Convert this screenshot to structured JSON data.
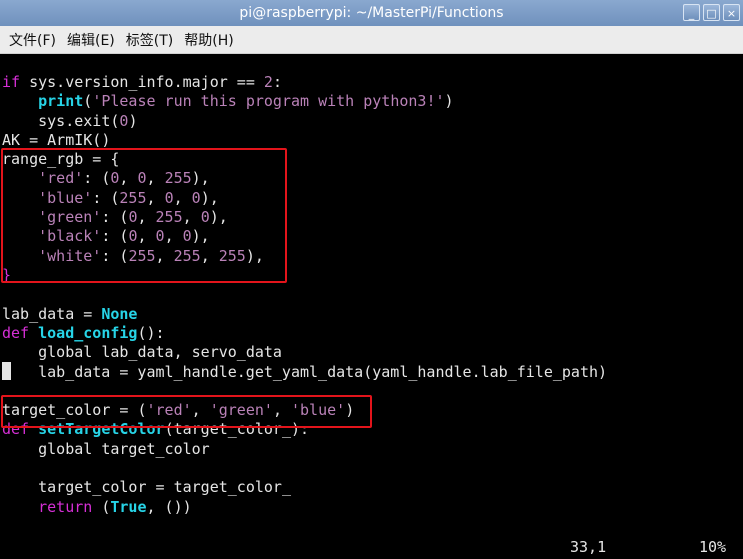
{
  "window": {
    "title": "pi@raspberrypi: ~/MasterPi/Functions",
    "controls": [
      "_",
      "□",
      "×"
    ]
  },
  "menu": [
    "文件(F)",
    "编辑(E)",
    "标签(T)",
    "帮助(H)"
  ],
  "code": [
    {
      "name": "code-line-if-version",
      "tokens": [
        {
          "t": "if",
          "c": "kw"
        },
        {
          "t": " sys.version_info.major == "
        },
        {
          "t": "2",
          "c": "num"
        },
        {
          "t": ":"
        }
      ]
    },
    {
      "name": "code-line-print",
      "tokens": [
        {
          "t": "    "
        },
        {
          "t": "print",
          "c": "fn"
        },
        {
          "t": "("
        },
        {
          "t": "'Please run this program with python3!'",
          "c": "str"
        },
        {
          "t": ")"
        }
      ]
    },
    {
      "name": "code-line-exit",
      "tokens": [
        {
          "t": "    sys.exit("
        },
        {
          "t": "0",
          "c": "num"
        },
        {
          "t": ")"
        }
      ]
    },
    {
      "name": "code-line-ak",
      "tokens": [
        {
          "t": "AK = ArmIK()"
        }
      ]
    },
    {
      "name": "code-line-range-rgb",
      "tokens": [
        {
          "t": "range_rgb = {"
        }
      ]
    },
    {
      "name": "code-line-red",
      "tokens": [
        {
          "t": "    "
        },
        {
          "t": "'red'",
          "c": "str"
        },
        {
          "t": ": ("
        },
        {
          "t": "0",
          "c": "num"
        },
        {
          "t": ", "
        },
        {
          "t": "0",
          "c": "num"
        },
        {
          "t": ", "
        },
        {
          "t": "255",
          "c": "num"
        },
        {
          "t": "),"
        }
      ]
    },
    {
      "name": "code-line-blue",
      "tokens": [
        {
          "t": "    "
        },
        {
          "t": "'blue'",
          "c": "str"
        },
        {
          "t": ": ("
        },
        {
          "t": "255",
          "c": "num"
        },
        {
          "t": ", "
        },
        {
          "t": "0",
          "c": "num"
        },
        {
          "t": ", "
        },
        {
          "t": "0",
          "c": "num"
        },
        {
          "t": "),"
        }
      ]
    },
    {
      "name": "code-line-green",
      "tokens": [
        {
          "t": "    "
        },
        {
          "t": "'green'",
          "c": "str"
        },
        {
          "t": ": ("
        },
        {
          "t": "0",
          "c": "num"
        },
        {
          "t": ", "
        },
        {
          "t": "255",
          "c": "num"
        },
        {
          "t": ", "
        },
        {
          "t": "0",
          "c": "num"
        },
        {
          "t": "),"
        }
      ]
    },
    {
      "name": "code-line-black",
      "tokens": [
        {
          "t": "    "
        },
        {
          "t": "'black'",
          "c": "str"
        },
        {
          "t": ": ("
        },
        {
          "t": "0",
          "c": "num"
        },
        {
          "t": ", "
        },
        {
          "t": "0",
          "c": "num"
        },
        {
          "t": ", "
        },
        {
          "t": "0",
          "c": "num"
        },
        {
          "t": "),"
        }
      ]
    },
    {
      "name": "code-line-white",
      "tokens": [
        {
          "t": "    "
        },
        {
          "t": "'white'",
          "c": "str"
        },
        {
          "t": ": ("
        },
        {
          "t": "255",
          "c": "num"
        },
        {
          "t": ", "
        },
        {
          "t": "255",
          "c": "num"
        },
        {
          "t": ", "
        },
        {
          "t": "255",
          "c": "num"
        },
        {
          "t": "),"
        }
      ]
    },
    {
      "name": "code-line-close-brace",
      "tokens": [
        {
          "t": "}",
          "c": "kw"
        }
      ]
    },
    {
      "name": "code-line-blank-1",
      "tokens": []
    },
    {
      "name": "code-line-lab-data",
      "tokens": [
        {
          "t": "lab_data = "
        },
        {
          "t": "None",
          "c": "const"
        }
      ]
    },
    {
      "name": "code-line-def-load-config",
      "tokens": [
        {
          "t": "def",
          "c": "kw"
        },
        {
          "t": " "
        },
        {
          "t": "load_config",
          "c": "fn"
        },
        {
          "t": "():"
        }
      ]
    },
    {
      "name": "code-line-global-lab",
      "tokens": [
        {
          "t": "    global lab_data, servo_data"
        }
      ]
    },
    {
      "name": "code-line-lab-yaml",
      "cursor": true,
      "tokens": [
        {
          "t": "   lab_data = yaml_handle.get_yaml_data(yaml_handle.lab_file_path)"
        }
      ]
    },
    {
      "name": "code-line-blank-2",
      "tokens": []
    },
    {
      "name": "code-line-target-color",
      "tokens": [
        {
          "t": "target_color = ("
        },
        {
          "t": "'red'",
          "c": "str"
        },
        {
          "t": ", "
        },
        {
          "t": "'green'",
          "c": "str"
        },
        {
          "t": ", "
        },
        {
          "t": "'blue'",
          "c": "str"
        },
        {
          "t": ")"
        }
      ]
    },
    {
      "name": "code-line-def-set-target",
      "tokens": [
        {
          "t": "def",
          "c": "kw"
        },
        {
          "t": " "
        },
        {
          "t": "setTargetColor",
          "c": "fn"
        },
        {
          "t": "(target_color_):"
        }
      ]
    },
    {
      "name": "code-line-global-target",
      "tokens": [
        {
          "t": "    global target_color"
        }
      ]
    },
    {
      "name": "code-line-blank-3",
      "tokens": []
    },
    {
      "name": "code-line-assign-target",
      "tokens": [
        {
          "t": "    target_color = target_color_"
        }
      ]
    },
    {
      "name": "code-line-return",
      "tokens": [
        {
          "t": "    "
        },
        {
          "t": "return",
          "c": "kw"
        },
        {
          "t": " ("
        },
        {
          "t": "True",
          "c": "const"
        },
        {
          "t": ", ())"
        }
      ]
    }
  ],
  "status": {
    "position": "33,1",
    "percent": "10%"
  },
  "colors": {
    "highlight_box": "#e3141b",
    "keyword": "#d62fd6",
    "function": "#27d4e7",
    "string": "#ba82b8"
  }
}
